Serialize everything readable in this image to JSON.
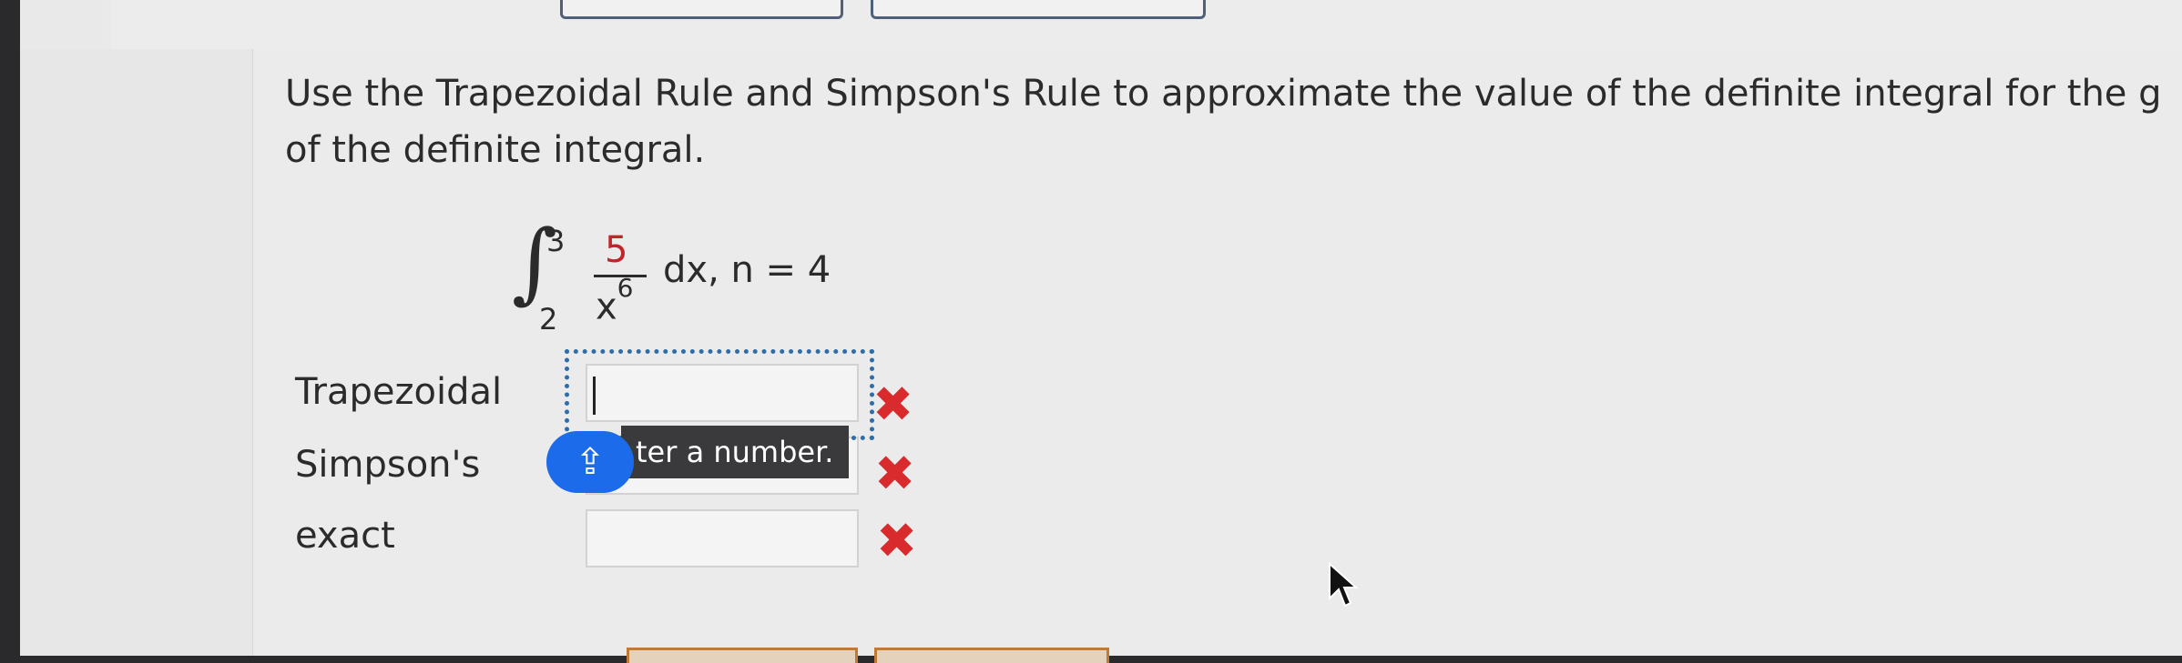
{
  "question": {
    "line1": "Use the Trapezoidal Rule and Simpson's Rule to approximate the value of the definite integral for the g",
    "line2": "of the definite integral."
  },
  "integral": {
    "upper": "3",
    "lower": "2",
    "numerator": "5",
    "denominator": "x",
    "exponent": "6",
    "rest": "dx,  n = 4"
  },
  "rows": [
    {
      "label": "Trapezoidal",
      "value": ""
    },
    {
      "label": "Simpson's",
      "value": ""
    },
    {
      "label": "exact",
      "value": ""
    }
  ],
  "tooltip": {
    "text": "ter a number.",
    "icon": "shift-up-arrow-icon"
  },
  "colors": {
    "error": "#d92a2e",
    "focus": "#2e6da8",
    "tooltip_icon_bg": "#1b6bea",
    "numerator": "#c0252a"
  }
}
